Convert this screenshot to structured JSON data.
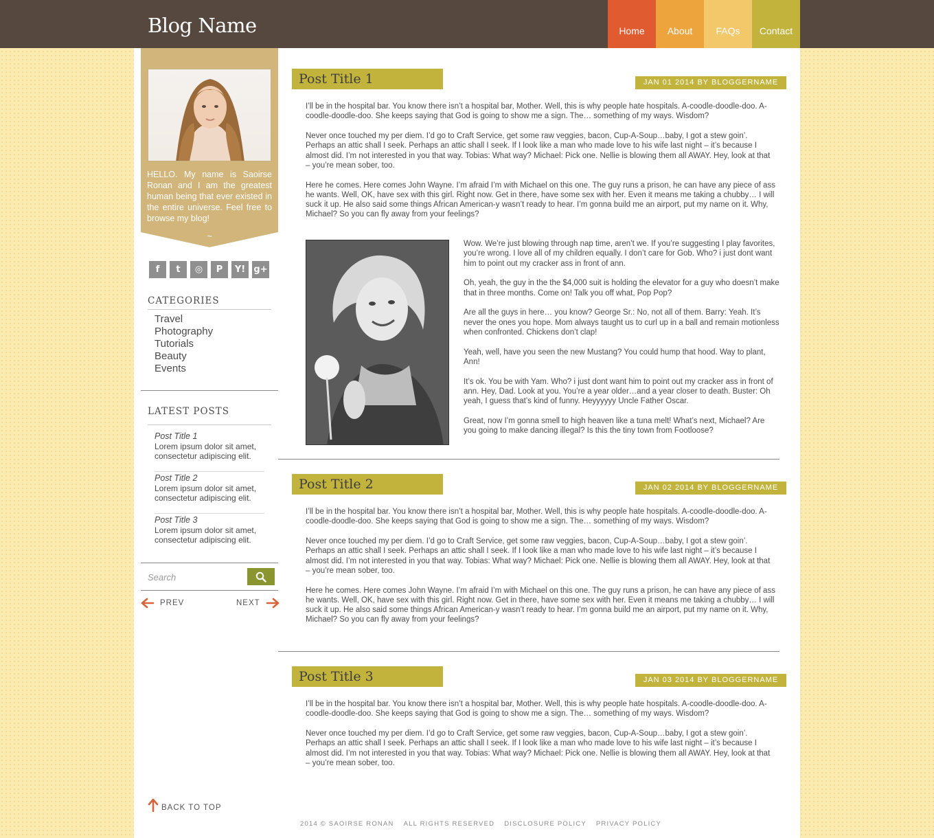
{
  "header": {
    "blog_name": "Blog Name",
    "nav": [
      {
        "label": "Home",
        "color": "#e05b30"
      },
      {
        "label": "About",
        "color": "#eda43d"
      },
      {
        "label": "FAQs",
        "color": "#f3c86a"
      },
      {
        "label": "Contact",
        "color": "#c1b33c"
      }
    ]
  },
  "sidebar": {
    "bio": "HELLO. My name is Saoirse Ronan and I am the greatest human being that ever existed in the entire universe. Feel free to browse my blog!",
    "tilde": "~",
    "social_icons": [
      {
        "name": "facebook-icon",
        "glyph": "f"
      },
      {
        "name": "twitter-icon",
        "glyph": "t"
      },
      {
        "name": "instagram-icon",
        "glyph": "◎"
      },
      {
        "name": "pinterest-icon",
        "glyph": "P"
      },
      {
        "name": "yahoo-icon",
        "glyph": "Y!"
      },
      {
        "name": "google-plus-icon",
        "glyph": "g+"
      }
    ],
    "categories_heading": "CATEGORIES",
    "categories": [
      "Travel",
      "Photography",
      "Tutorials",
      "Beauty",
      "Events"
    ],
    "latest_heading": "LATEST POSTS",
    "latest_posts": [
      {
        "title": "Post Title 1",
        "excerpt": "Lorem ipsum dolor sit amet, consectetur adipiscing elit."
      },
      {
        "title": "Post Title 2",
        "excerpt": "Lorem ipsum dolor sit amet, consectetur adipiscing elit."
      },
      {
        "title": "Post Title 3",
        "excerpt": "Lorem ipsum dolor sit amet, consectetur adipiscing elit."
      }
    ],
    "search_placeholder": "Search",
    "prev_label": "PREV",
    "next_label": "NEXT",
    "back_to_top": "BACK TO TOP"
  },
  "posts": [
    {
      "title": "Post Title 1",
      "meta": "JAN 01 2014 BY BLOGGERNAME",
      "paragraphs": [
        "I’ll be in the hospital bar. You know there isn’t a hospital bar, Mother. Well, this is why people hate hospitals. A-coodle-doodle-doo. A-coodle-doodle-doo. She keeps saying that God is going to show me a sign. The… something of my ways. Wisdom?",
        "Never once touched my per diem. I’d go to Craft Service, get some raw veggies, bacon, Cup-A-Soup…baby, I got a stew goin’. Perhaps an attic shall I seek. Perhaps an attic shall I seek. If I look like a man who made love to his wife last night – it’s because I almost did. I’m not interested in you that way. Tobias: What way? Michael: Pick one. Nellie is blowing them all AWAY. Hey, look at that – you’re mean sober, too.",
        "Here he comes. Here comes John Wayne. I’m afraid I’m with Michael on this one. The guy runs a prison, he can have any piece of ass he wants. Well, OK, have sex with this girl. Right now. Get in there, have some sex with her. Even it means me taking a chubby… I will suck it up. He also said some things African American-y wasn’t ready to hear. I’m gonna build me an airport, put my name on it. Why, Michael? So you can fly away from your feelings?"
      ],
      "photo_paragraphs": [
        "Wow. We’re just blowing through nap time, aren’t we. If you’re suggesting I play favorites, you’re wrong. I love all of my children equally. I don’t care for Gob. Who? i just dont want him to point out my cracker ass in front of ann.",
        "Oh, yeah, the guy in the the $4,000 suit is holding the elevator for a guy who doesn’t make that in three months. Come on! Talk you off what, Pop Pop?",
        "Are all the guys in here… you know? George Sr.: No, not all of them. Barry: Yeah. It’s never the ones you hope. Mom always taught us to curl up in a ball and remain motionless when confronted. Chickens don’t clap!",
        "Yeah, well, have you seen the new Mustang? You could hump that hood. Way to plant, Ann!",
        "It’s ok. You be with Yam. Who? i just dont want him to point out my cracker ass in front of ann. Hey, Dad. Look at you. You’re a year older…and a year closer to death. Buster: Oh yeah, I guess that’s kind of funny. Heyyyyyy Uncle Father Oscar.",
        "Great, now I’m gonna smell to high heaven like a tuna melt! What’s next, Michael? Are you going to make dancing illegal? Is this the tiny town from Footloose?"
      ]
    },
    {
      "title": "Post Title 2",
      "meta": "JAN 02 2014 BY BLOGGERNAME",
      "paragraphs": [
        "I’ll be in the hospital bar. You know there isn’t a hospital bar, Mother. Well, this is why people hate hospitals. A-coodle-doodle-doo. A-coodle-doodle-doo. She keeps saying that God is going to show me a sign. The… something of my ways. Wisdom?",
        "Never once touched my per diem. I’d go to Craft Service, get some raw veggies, bacon, Cup-A-Soup…baby, I got a stew goin’. Perhaps an attic shall I seek. Perhaps an attic shall I seek. If I look like a man who made love to his wife last night – it’s because I almost did. I’m not interested in you that way. Tobias: What way? Michael: Pick one. Nellie is blowing them all AWAY. Hey, look at that – you’re mean sober, too.",
        "Here he comes. Here comes John Wayne. I’m afraid I’m with Michael on this one. The guy runs a prison, he can have any piece of ass he wants. Well, OK, have sex with this girl. Right now. Get in there, have some sex with her. Even it means me taking a chubby… I will suck it up. He also said some things African American-y wasn’t ready to hear. I’m gonna build me an airport, put my name on it. Why, Michael? So you can fly away from your feelings?"
      ]
    },
    {
      "title": "Post Title 3",
      "meta": "JAN 03 2014 BY BLOGGERNAME",
      "paragraphs": [
        "I’ll be in the hospital bar. You know there isn’t a hospital bar, Mother. Well, this is why people hate hospitals. A-coodle-doodle-doo. A-coodle-doodle-doo. She keeps saying that God is going to show me a sign. The… something of my ways. Wisdom?",
        "Never once touched my per diem. I’d go to Craft Service, get some raw veggies, bacon, Cup-A-Soup…baby, I got a stew goin’. Perhaps an attic shall I seek. Perhaps an attic shall I seek. If I look like a man who made love to his wife last night – it’s because I almost did. I’m not interested in you that way. Tobias: What way? Michael: Pick one. Nellie is blowing them all AWAY. Hey, look at that – you’re mean sober, too."
      ]
    }
  ],
  "footer": {
    "copyright": "2014 © SAOIRSE RONAN",
    "rights": "ALL RIGHTS RESERVED",
    "disclosure": "DISCLOSURE POLICY",
    "privacy": "PRIVACY POLICY"
  }
}
